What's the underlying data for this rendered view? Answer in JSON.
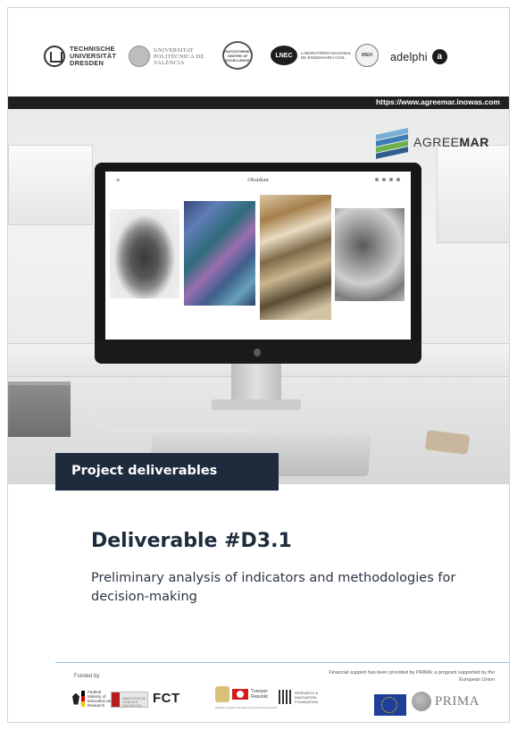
{
  "header": {
    "logos": {
      "tud": "TECHNISCHE UNIVERSITÄT DRESDEN",
      "upv": "UNIVERSITAT POLITÈCNICA DE VALÈNCIA",
      "eratosthenes": "ERATOSTHENES CENTRE OF EXCELLENCE",
      "lnec_mark": "LNEC",
      "lnec": "LABORATÓRIO NACIONAL DE ENGENHARIA CIVIL",
      "ireh": "IREH",
      "adelphi": "adelphi",
      "adelphi_mark": "a"
    },
    "url": "https://www.agreemar.inowas.com"
  },
  "cover_image": {
    "screen_title": "Obsidian",
    "screen_menu": "≡",
    "project_logo": {
      "agree": "AGREE",
      "mar": "MAR"
    }
  },
  "label": "Project deliverables",
  "title": "Deliverable #D3.1",
  "subtitle": "Preliminary analysis of indicators and methodologies for decision-making",
  "footer": {
    "funded_by": "Funded by",
    "financial_support": "Financial support has been provided by PRIMA; a program supported by the European Union",
    "logos": {
      "bmbf": "Federal Ministry of Education and Research",
      "spain": "MINISTERIO DE CIENCIA E INNOVACIÓN",
      "fct": "FCT",
      "tunisia": "Tunisian Republic",
      "tunisia_ministry": "Ministry of Higher Education and Scientific Research",
      "rif": "RESEARCH & INNOVATION FOUNDATION",
      "prima": "PRIMA"
    }
  },
  "colors": {
    "navy": "#1e2b3d",
    "rule": "#9ac4e4"
  }
}
